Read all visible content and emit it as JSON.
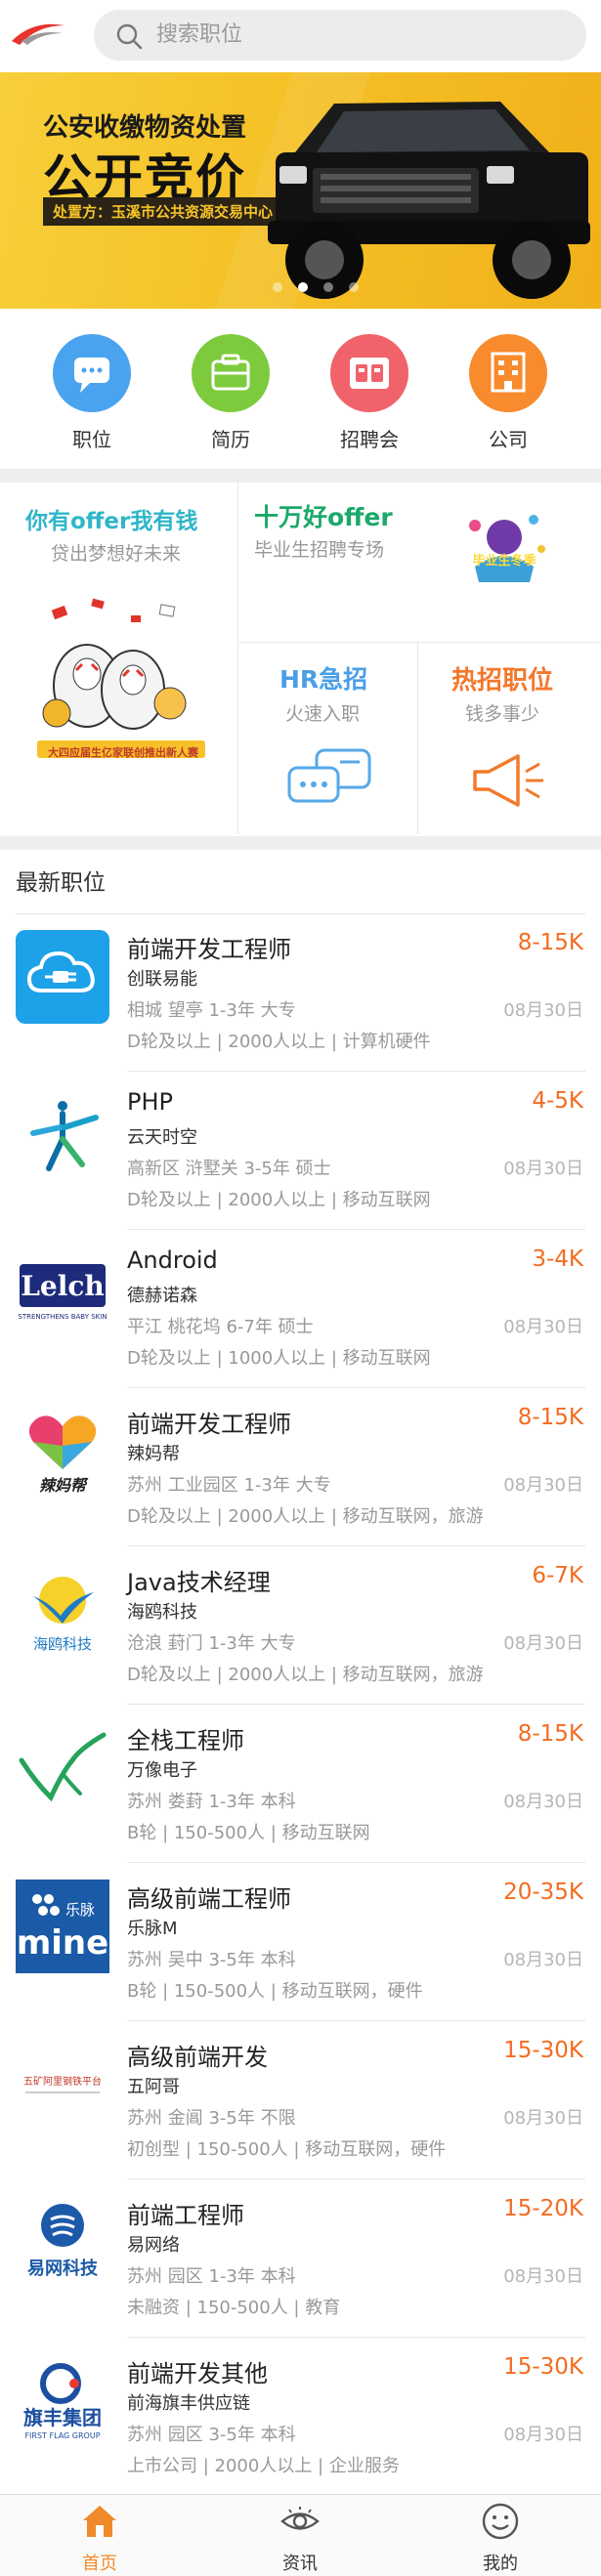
{
  "search": {
    "placeholder": "搜索职位"
  },
  "banner": {
    "line1": "公安收缴物资处置",
    "line2": "公开竞价",
    "line3": "处置方：玉溪市公共资源交易中心"
  },
  "quicknav": [
    {
      "label": "职位",
      "color": "#4aa3ee",
      "icon": "chat-bubble-icon"
    },
    {
      "label": "简历",
      "color": "#7dcb3c",
      "icon": "briefcase-icon"
    },
    {
      "label": "招聘会",
      "color": "#f0636a",
      "icon": "id-card-icon"
    },
    {
      "label": "公司",
      "color": "#f78b2e",
      "icon": "building-icon"
    }
  ],
  "promo": {
    "offer": {
      "title": "你有offer我有钱",
      "sub": "贷出梦想好未来",
      "caption": "大四应届生亿家联创推出新人赛"
    },
    "graduate": {
      "title": "十万好offer",
      "sub": "毕业生招聘专场",
      "badge": "毕业生冬季"
    },
    "hr": {
      "title": "HR急招",
      "sub": "火速入职"
    },
    "hot": {
      "title": "热招职位",
      "sub": "钱多事少"
    }
  },
  "jobs_title": "最新职位",
  "jobs": [
    {
      "title": "前端开发工程师",
      "salary": "8-15K",
      "company": "创联易能",
      "meta": "相城  望亭  1-3年  大专",
      "date": "08月30日",
      "tags": "D轮及以上 | 2000人以上 | 计算机硬件",
      "logo": "cloud-plug-logo"
    },
    {
      "title": "PHP",
      "salary": "4-5K",
      "company": "云天时空",
      "meta": "高新区  浒墅关  3-5年  硕士",
      "date": "08月30日",
      "tags": "D轮及以上 | 2000人以上 | 移动互联网",
      "logo": "figure-logo"
    },
    {
      "title": "Android",
      "salary": "3-4K",
      "company": "德赫诺森",
      "meta": "平江  桃花坞  6-7年  硕士",
      "date": "08月30日",
      "tags": "D轮及以上 | 1000人以上 | 移动互联网",
      "logo": "lelch-logo",
      "logo_text": "Lelch",
      "logo_sub": "STRENGTHENS BABY SKIN"
    },
    {
      "title": "前端开发工程师",
      "salary": "8-15K",
      "company": "辣妈帮",
      "meta": "苏州  工业园区  1-3年  大专",
      "date": "08月30日",
      "tags": "D轮及以上 | 2000人以上 | 移动互联网，旅游",
      "logo": "heart-logo",
      "logo_text": "辣妈帮"
    },
    {
      "title": "Java技术经理",
      "salary": "6-7K",
      "company": "海鸥科技",
      "meta": "沧浪  葑门  1-3年  大专",
      "date": "08月30日",
      "tags": "D轮及以上 | 2000人以上 | 移动互联网，旅游",
      "logo": "seagull-logo",
      "logo_text": "海鸥科技"
    },
    {
      "title": "全栈工程师",
      "salary": "8-15K",
      "company": "万像电子",
      "meta": "苏州  娄葑  1-3年  本科",
      "date": "08月30日",
      "tags": "B轮 | 150-500人 | 移动互联网",
      "logo": "wave-logo"
    },
    {
      "title": "高级前端工程师",
      "salary": "20-35K",
      "company": "乐脉M",
      "meta": "苏州  吴中  3-5年  本科",
      "date": "08月30日",
      "tags": "B轮 | 150-500人 | 移动互联网，硬件",
      "logo": "mine-logo",
      "logo_text": "mine",
      "logo_sub": "乐脉"
    },
    {
      "title": "高级前端开发",
      "salary": "15-30K",
      "company": "五阿哥",
      "meta": "苏州  金阊  3-5年  不限",
      "date": "08月30日",
      "tags": "初创型 | 150-500人 | 移动互联网，硬件",
      "logo": "steel-platform-logo",
      "logo_text": "五矿阿里钢铁平台"
    },
    {
      "title": "前端工程师",
      "salary": "15-20K",
      "company": "易网络",
      "meta": "苏州  园区  1-3年  本科",
      "date": "08月30日",
      "tags": "未融资 | 150-500人 | 教育",
      "logo": "yiwang-logo",
      "logo_text": "易网科技"
    },
    {
      "title": "前端开发其他",
      "salary": "15-30K",
      "company": "前海旗丰供应链",
      "meta": "苏州  园区  3-5年  本科",
      "date": "08月30日",
      "tags": "上市公司 | 2000人以上 | 企业服务",
      "logo": "qifeng-logo",
      "logo_text": "旗丰集团",
      "logo_sub": "FIRST FLAG GROUP"
    }
  ],
  "tabs": [
    {
      "label": "首页",
      "icon": "home-icon",
      "active": true
    },
    {
      "label": "资讯",
      "icon": "eye-icon",
      "active": false
    },
    {
      "label": "我的",
      "icon": "smiley-icon",
      "active": false
    }
  ]
}
